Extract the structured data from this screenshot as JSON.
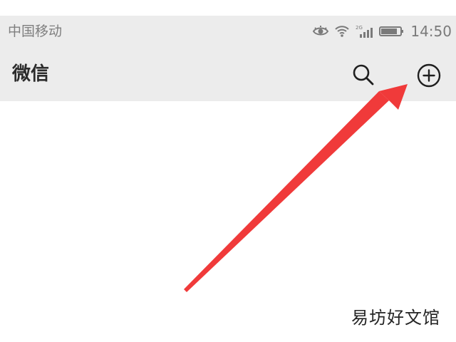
{
  "status_bar": {
    "carrier": "中国移动",
    "network_label": "2G",
    "time": "14:50"
  },
  "app_bar": {
    "title": "微信"
  },
  "watermark": {
    "text": "易坊好文馆"
  },
  "icons": {
    "eye": "eye-icon",
    "wifi": "wifi-icon",
    "signal": "signal-icon",
    "battery": "battery-icon",
    "search": "search-icon",
    "add": "add-circle-icon",
    "annotation_arrow": "arrow-pointer"
  },
  "colors": {
    "status_bar_bg": "#ececec",
    "app_bar_bg": "#ececec",
    "arrow_color": "#f03a3a",
    "title_color": "#2b2b2b"
  }
}
